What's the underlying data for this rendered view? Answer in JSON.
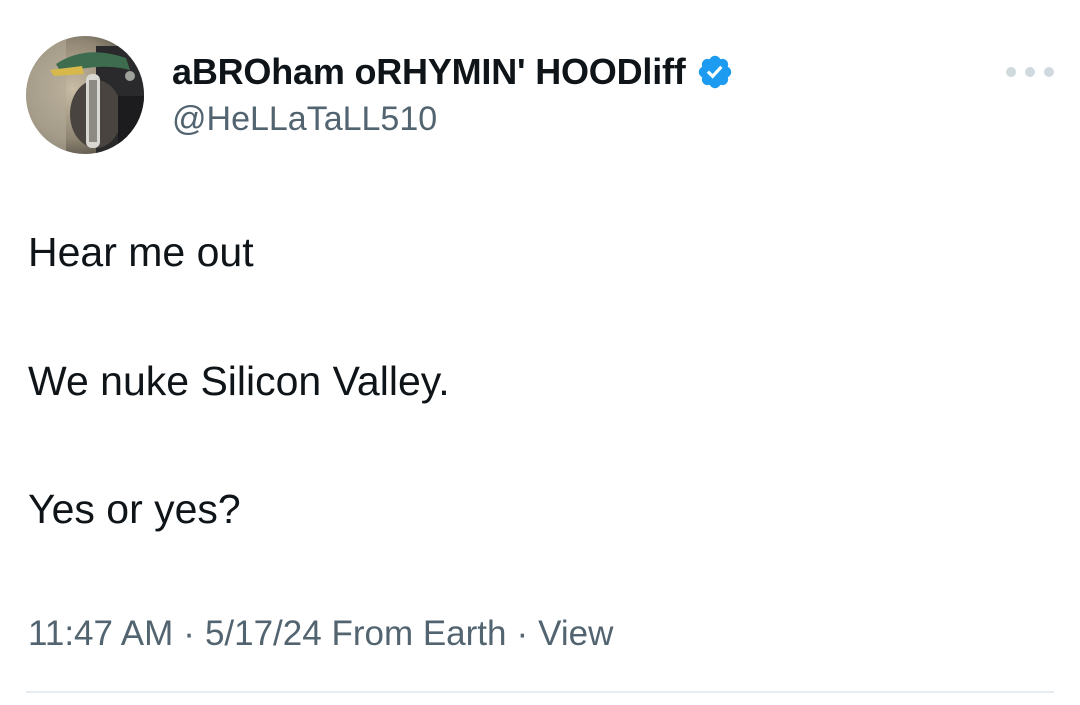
{
  "author": {
    "display_name": "aBROham oRHYMIN' HOODliff",
    "handle": "@HeLLaTaLL510",
    "verified": true,
    "verified_color": "#1d9bf0"
  },
  "tweet": {
    "lines": [
      "Hear me out",
      "We nuke Silicon Valley.",
      "Yes or yes?"
    ]
  },
  "meta": {
    "time": "11:47 AM",
    "separator": "·",
    "date": "5/17/24",
    "source": "From Earth",
    "views": "View"
  },
  "icons": {
    "avatar": "profile-photo",
    "verified": "verified-badge-icon",
    "more": "more-options-icon"
  }
}
